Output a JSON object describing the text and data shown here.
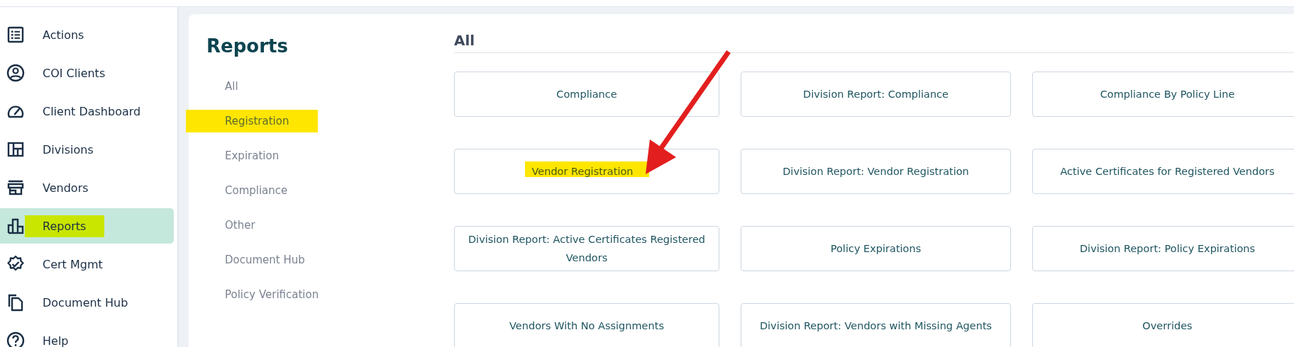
{
  "sidebar": {
    "items": [
      {
        "label": "Actions",
        "selected": false,
        "highlighted": false
      },
      {
        "label": "COI Clients",
        "selected": false,
        "highlighted": false
      },
      {
        "label": "Client Dashboard",
        "selected": false,
        "highlighted": false
      },
      {
        "label": "Divisions",
        "selected": false,
        "highlighted": false
      },
      {
        "label": "Vendors",
        "selected": false,
        "highlighted": false
      },
      {
        "label": "Reports",
        "selected": true,
        "highlighted": true
      },
      {
        "label": "Cert Mgmt",
        "selected": false,
        "highlighted": false
      },
      {
        "label": "Document Hub",
        "selected": false,
        "highlighted": false
      },
      {
        "label": "Help",
        "selected": false,
        "highlighted": false
      }
    ]
  },
  "page": {
    "title": "Reports",
    "categories": [
      {
        "label": "All",
        "highlighted": false
      },
      {
        "label": "Registration",
        "highlighted": true
      },
      {
        "label": "Expiration",
        "highlighted": false
      },
      {
        "label": "Compliance",
        "highlighted": false
      },
      {
        "label": "Other",
        "highlighted": false
      },
      {
        "label": "Document Hub",
        "highlighted": false
      },
      {
        "label": "Policy Verification",
        "highlighted": false
      }
    ],
    "section_title": "All",
    "reports": [
      {
        "label": "Compliance",
        "highlighted": false
      },
      {
        "label": "Division Report: Compliance",
        "highlighted": false
      },
      {
        "label": "Compliance By Policy Line",
        "highlighted": false
      },
      {
        "label": "Vendor Registration",
        "highlighted": true
      },
      {
        "label": "Division Report: Vendor Registration",
        "highlighted": false
      },
      {
        "label": "Active Certificates for Registered Vendors",
        "highlighted": false
      },
      {
        "label": "Division Report: Active Certificates Registered Vendors",
        "highlighted": false
      },
      {
        "label": "Policy Expirations",
        "highlighted": false
      },
      {
        "label": "Division Report: Policy Expirations",
        "highlighted": false
      },
      {
        "label": "Vendors With No Assignments",
        "highlighted": false
      },
      {
        "label": "Division Report: Vendors with Missing Agents",
        "highlighted": false
      },
      {
        "label": "Overrides",
        "highlighted": false
      }
    ]
  }
}
